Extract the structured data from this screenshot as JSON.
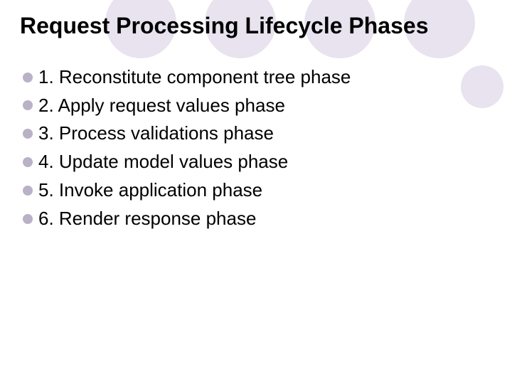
{
  "slide": {
    "title": "Request Processing Lifecycle Phases",
    "items": [
      "1. Reconstitute component tree phase",
      "2. Apply request values phase",
      "3. Process validations phase",
      "4. Update model values phase",
      "5. Invoke application phase",
      "6. Render response phase"
    ]
  }
}
